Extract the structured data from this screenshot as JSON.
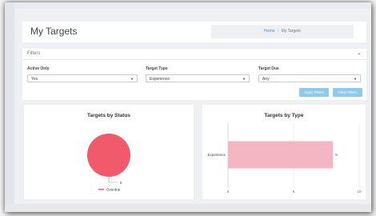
{
  "page": {
    "title": "My Targets",
    "breadcrumb": {
      "home": "Home",
      "separator": "/",
      "current": "My Targets"
    }
  },
  "filters": {
    "title": "Filters",
    "active_only": {
      "label": "Active Only",
      "value": "Yes"
    },
    "target_type": {
      "label": "Target Type",
      "value": "Experience"
    },
    "target_due": {
      "label": "Target Due",
      "value": "Any"
    },
    "apply_label": "Apply Filters",
    "clear_label": "Clear Filters",
    "button_color": "#8ec9ee"
  },
  "status_panel": {
    "title": "Targets by Status"
  },
  "type_panel": {
    "title": "Targets by Type"
  },
  "chart_data": [
    {
      "type": "pie",
      "title": "Targets by Status",
      "slices": [
        {
          "name": "Overdue",
          "value": 8,
          "color": "#f05a6a"
        }
      ],
      "data_labels": [
        "8"
      ],
      "legend": {
        "placement": "bottom",
        "entries": [
          "Overdue"
        ]
      }
    },
    {
      "type": "bar",
      "orientation": "horizontal",
      "title": "Targets by Type",
      "categories": [
        "Experience"
      ],
      "values": [
        8
      ],
      "data_labels": [
        "8"
      ],
      "xlim": [
        0,
        10
      ],
      "x_ticks": [
        "0",
        "5",
        "10"
      ],
      "grid": true,
      "color": "#f4b6c2"
    }
  ]
}
